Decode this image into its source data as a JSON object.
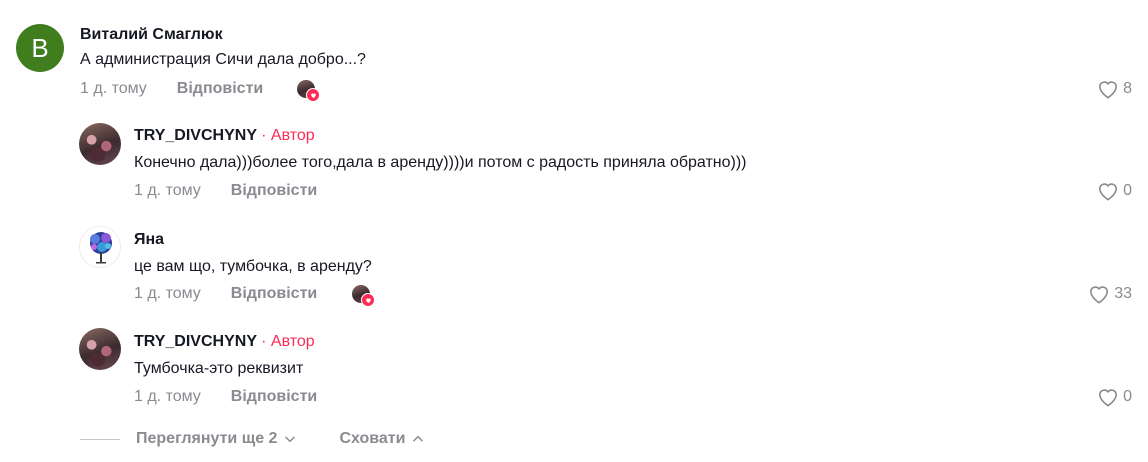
{
  "comments": [
    {
      "author": "Виталий Смаглюк",
      "avatar_letter": "В",
      "text": "А администрация Сичи дала добро...?",
      "time": "1 д. тому",
      "reply_label": "Відповісти",
      "likes": "8"
    },
    {
      "author": "TRY_DIVCHYNY",
      "badge": "· Автор",
      "text": "Конечно дала)))более того,дала в аренду))))и потом с радость приняла обратно)))",
      "time": "1 д. тому",
      "reply_label": "Відповісти",
      "likes": "0"
    },
    {
      "author": "Яна",
      "text": "це вам що, тумбочка, в аренду?",
      "time": "1 д. тому",
      "reply_label": "Відповісти",
      "likes": "33"
    },
    {
      "author": "TRY_DIVCHYNY",
      "badge": "· Автор",
      "text": "Тумбочка-это реквизит",
      "time": "1 д. тому",
      "reply_label": "Відповісти",
      "likes": "0"
    }
  ],
  "footer": {
    "view_more": "Переглянути ще 2",
    "hide": "Сховати"
  },
  "colors": {
    "accent": "#fe2c55",
    "avatar_green": "#3f7d1f",
    "muted": "#8a8b91"
  },
  "icons": [
    "heart-outline-icon",
    "chevron-down-icon",
    "chevron-up-icon",
    "liked-by-creator-icon"
  ]
}
